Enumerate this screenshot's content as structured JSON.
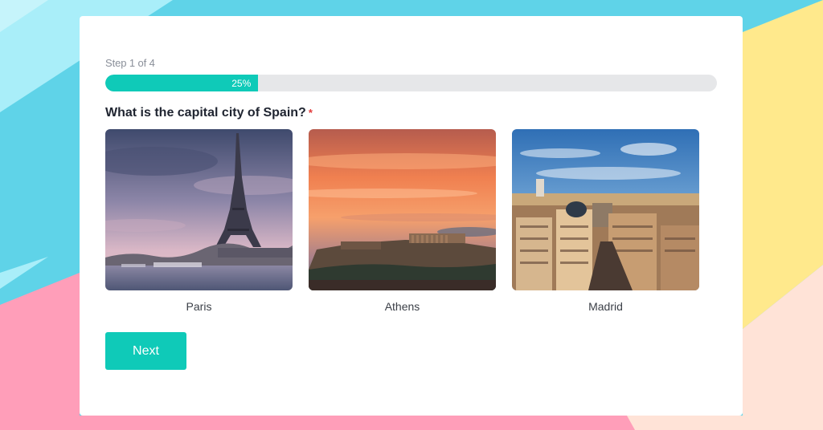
{
  "quiz": {
    "step_label": "Step 1 of 4",
    "progress": {
      "value_percent": 25,
      "label": "25%"
    },
    "question": "What is the capital city of Spain?",
    "required_marker": "*",
    "options": [
      {
        "label": "Paris",
        "image": "eiffel-tower-photo"
      },
      {
        "label": "Athens",
        "image": "acropolis-sunset-photo"
      },
      {
        "label": "Madrid",
        "image": "madrid-cityscape-photo"
      }
    ],
    "next_label": "Next"
  },
  "colors": {
    "accent": "#0fcab8",
    "background_cyan": "#5fd3e8",
    "background_light_cyan": "#a9eef9",
    "background_yellow": "#ffe98c",
    "background_pink": "#ff9eb9",
    "background_peach": "#ffe3d7",
    "required": "#e23b3b"
  }
}
